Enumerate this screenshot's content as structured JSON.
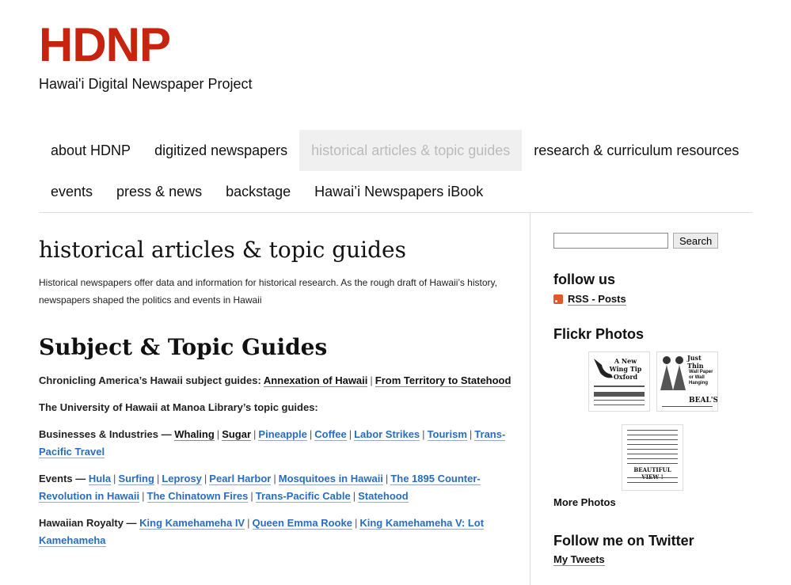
{
  "site": {
    "title": "HDNP",
    "description": "Hawai'i Digital Newspaper Project"
  },
  "nav": {
    "row1": [
      "about HDNP",
      "digitized newspapers",
      "historical articles & topic guides",
      "research & curriculum resources"
    ],
    "row2": [
      "events",
      "press & news",
      "backstage",
      "Hawai’i Newspapers iBook"
    ]
  },
  "main": {
    "page_title": "historical articles & topic guides",
    "intro": "Historical newspapers offer data and information for historical research. As the rough draft of Hawaii’s history, newspapers shaped the politics and events in Hawaii",
    "section_title": "Subject & Topic Guides",
    "chronicling": {
      "label": "Chronicling America’s Hawaii subject guides:",
      "links": [
        "Annexation of Hawaii",
        "From Territory to Statehood"
      ]
    },
    "uhm_label": "The University of Hawaii at Manoa Library’s topic guides:",
    "business": {
      "label": "Businesses & Industries —",
      "dark": [
        "Whaling",
        "Sugar"
      ],
      "blue": [
        "Pineapple",
        "Coffee",
        "Labor Strikes",
        "Tourism",
        "Trans-Pacific Travel"
      ]
    },
    "events": {
      "label": "Events —",
      "links": [
        "Hula",
        "Surfing",
        "Leprosy",
        "Pearl Harbor",
        "Mosquitoes in Hawaii",
        "The 1895 Counter-Revolution in Hawaii",
        "The Chinatown Fires",
        "Trans-Pacific Cable",
        "Statehood"
      ]
    },
    "royalty": {
      "label": "Hawaiian Royalty —",
      "links": [
        "King Kamehameha IV",
        "Queen Emma Rooke",
        "King Kamehameha V: Lot Kamehameha"
      ]
    },
    "separator": "|"
  },
  "sidebar": {
    "search_button": "Search",
    "follow_title": "follow us",
    "rss_label": "RSS - Posts",
    "flickr_title": "Flickr Photos",
    "more_photos": "More Photos",
    "twitter_title": "Follow me on Twitter",
    "my_tweets": "My Tweets",
    "photo_text": [
      "A New Wing Tip Oxford",
      "Just Thin",
      "Wall Paper or Wall Hanging",
      "BEAL'S",
      "BEAUTIFUL VIEW !"
    ]
  },
  "colors": {
    "brand": "#c8230f",
    "link_blue": "#2a6dbf",
    "nav_active_bg": "#f0f0f0"
  }
}
